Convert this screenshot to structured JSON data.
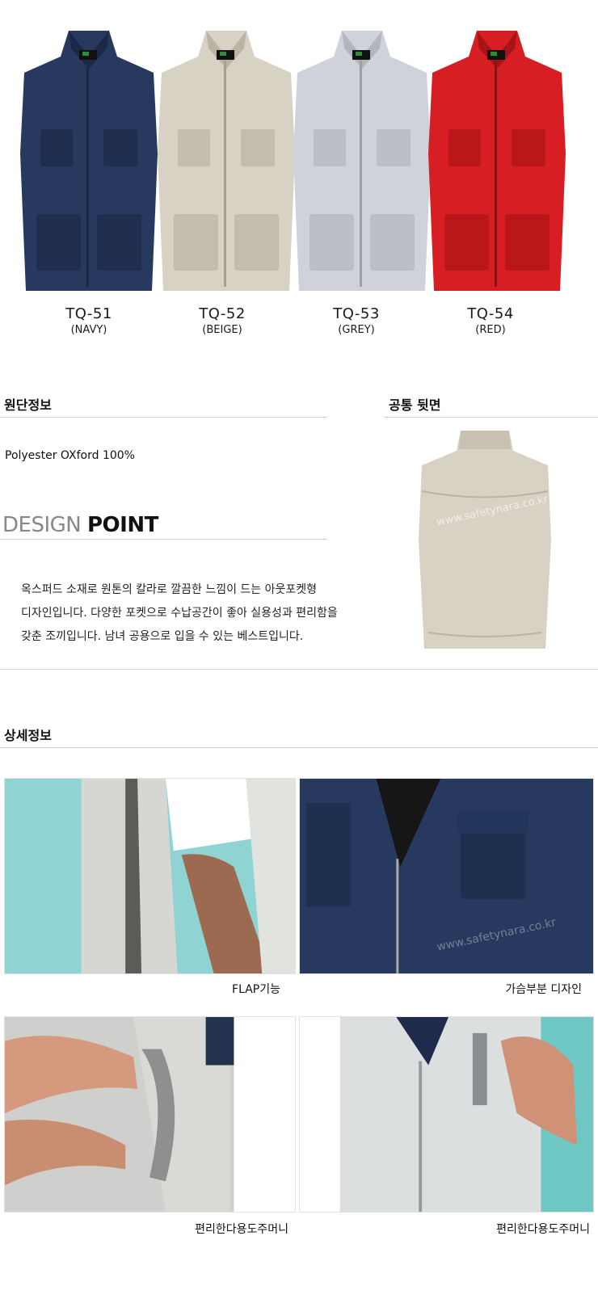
{
  "products": [
    {
      "code": "TQ-51",
      "color_name": "(NAVY)",
      "hex": "#27395e",
      "shade": "#1b2846"
    },
    {
      "code": "TQ-52",
      "color_name": "(BEIGE)",
      "hex": "#d8d2c4",
      "shade": "#bbb4a4"
    },
    {
      "code": "TQ-53",
      "color_name": "(GREY)",
      "hex": "#cfd3d9",
      "shade": "#b1b6be"
    },
    {
      "code": "TQ-54",
      "color_name": "(RED)",
      "hex": "#d71e22",
      "shade": "#a71317"
    }
  ],
  "watermark": "www.safetynara.co.kr",
  "fabric": {
    "title": "원단정보",
    "text": "Polyester OXford 100%"
  },
  "back": {
    "title": "공통 뒷면"
  },
  "design_point": {
    "light": "DESIGN",
    "bold": "POINT",
    "lines": [
      "옥스퍼드 소재로 원톤의 칼라로 깔끔한 느낌이 드는 아웃포켓형",
      "디자인입니다. 다양한 포켓으로 수납공간이 좋아 실용성과 편리함을",
      "갖춘 조끼입니다. 남녀 공용으로 입을 수 있는 베스트입니다."
    ]
  },
  "detail": {
    "title": "상세정보",
    "captions": [
      "FLAP기능",
      "가슴부분 디자인",
      "편리한다용도주머니",
      "편리한다용도주머니"
    ]
  }
}
